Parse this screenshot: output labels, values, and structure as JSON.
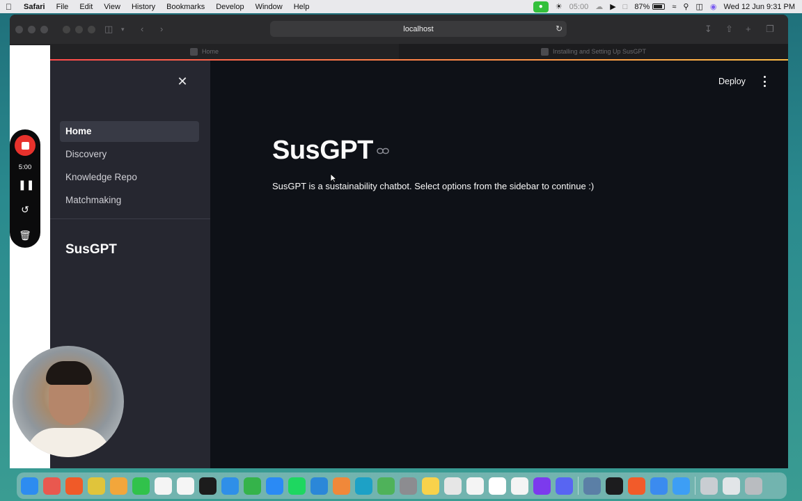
{
  "menubar": {
    "app": "Safari",
    "items": [
      "File",
      "Edit",
      "View",
      "History",
      "Bookmarks",
      "Develop",
      "Window",
      "Help"
    ],
    "timer": "05:00",
    "battery": "87%",
    "datetime": "Wed 12 Jun  9:31 PM"
  },
  "browser": {
    "url": "localhost",
    "tabs": [
      {
        "label": "Home"
      },
      {
        "label": "Installing and Setting Up SusGPT"
      }
    ]
  },
  "sidebar": {
    "nav": [
      {
        "label": "Home",
        "active": true
      },
      {
        "label": "Discovery"
      },
      {
        "label": "Knowledge Repo"
      },
      {
        "label": "Matchmaking"
      }
    ],
    "title": "SusGPT"
  },
  "header": {
    "deploy_label": "Deploy"
  },
  "main": {
    "title": "SusGPT",
    "description": "SusGPT is a sustainability chatbot. Select options from the sidebar to continue :)"
  },
  "recorder": {
    "time": "5:00"
  },
  "dock": {
    "icons": [
      {
        "name": "finder-icon",
        "color": "#2d8cf0"
      },
      {
        "name": "launchpad-icon",
        "color": "#e9584f"
      },
      {
        "name": "brave-icon",
        "color": "#f05a28"
      },
      {
        "name": "chrome-icon",
        "color": "#e0c43b"
      },
      {
        "name": "photos-icon",
        "color": "#f2a63b"
      },
      {
        "name": "facetime-icon",
        "color": "#31c24b"
      },
      {
        "name": "calendar-icon",
        "color": "#f4f4f4"
      },
      {
        "name": "reminders-icon",
        "color": "#f5f5f5"
      },
      {
        "name": "tv-icon",
        "color": "#1c1c1c"
      },
      {
        "name": "keynote-icon",
        "color": "#2f8fe8"
      },
      {
        "name": "numbers-icon",
        "color": "#35b34a"
      },
      {
        "name": "app-store-icon",
        "color": "#2a8af5"
      },
      {
        "name": "spotify-icon",
        "color": "#1ed760"
      },
      {
        "name": "vscode-icon",
        "color": "#2b87d8"
      },
      {
        "name": "books-icon",
        "color": "#f0883a"
      },
      {
        "name": "edge-icon",
        "color": "#1da1c6"
      },
      {
        "name": "maps-icon",
        "color": "#4fb25a"
      },
      {
        "name": "system-settings-icon",
        "color": "#8c8c90"
      },
      {
        "name": "notes-icon",
        "color": "#f8d24b"
      },
      {
        "name": "slack-icon",
        "color": "#e6e6e6"
      },
      {
        "name": "tasks-icon",
        "color": "#f4f4f4"
      },
      {
        "name": "notion-icon",
        "color": "#ffffff"
      },
      {
        "name": "calendar2-icon",
        "color": "#f4f4f4"
      },
      {
        "name": "github-icon",
        "color": "#7c3aed"
      },
      {
        "name": "discord-icon",
        "color": "#5865f2"
      },
      {
        "name": "preview-icon",
        "color": "#5b7fa6"
      },
      {
        "name": "terminal-icon",
        "color": "#1c1c1e"
      },
      {
        "name": "pencil-icon",
        "color": "#f25b2a"
      },
      {
        "name": "mail-icon",
        "color": "#3b8bef"
      },
      {
        "name": "safari-icon",
        "color": "#3d9ef5"
      },
      {
        "name": "document-icon",
        "color": "#c9cdd2"
      },
      {
        "name": "folder-icon",
        "color": "#e2e5e8"
      },
      {
        "name": "trash-icon",
        "color": "#b9bcc0"
      }
    ]
  }
}
